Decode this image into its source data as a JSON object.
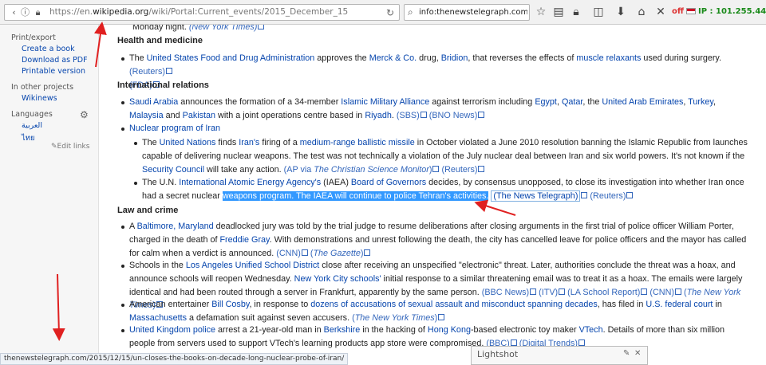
{
  "browser": {
    "url_prefix": "https://en.",
    "url_domain": "wikipedia.org",
    "url_path": "/wiki/Portal:Current_events/2015_December_15",
    "search_value": "info:thenewstelegraph.com",
    "ip_off": "off",
    "ip_text": "IP : 101.255.44.117"
  },
  "sidebar": {
    "print_export": "Print/export",
    "create_book": "Create a book",
    "download_pdf": "Download as PDF",
    "printable": "Printable version",
    "other_projects": "In other projects",
    "wikinews": "Wikinews",
    "languages": "Languages",
    "lang1": "العربية",
    "lang2": "ไทย",
    "edit_links": "Edit links"
  },
  "content": {
    "top_line": "Monday night.",
    "top_src": "(New York Times)",
    "h_health": "Health and medicine",
    "h_intl": "International relations",
    "h_law": "Law and crime"
  },
  "statusbar": {
    "url": "thenewstelegraph.com/2015/12/15/un-closes-the-books-on-decade-long-nuclear-probe-of-iran/"
  },
  "lightshot": {
    "title": "Lightshot"
  }
}
